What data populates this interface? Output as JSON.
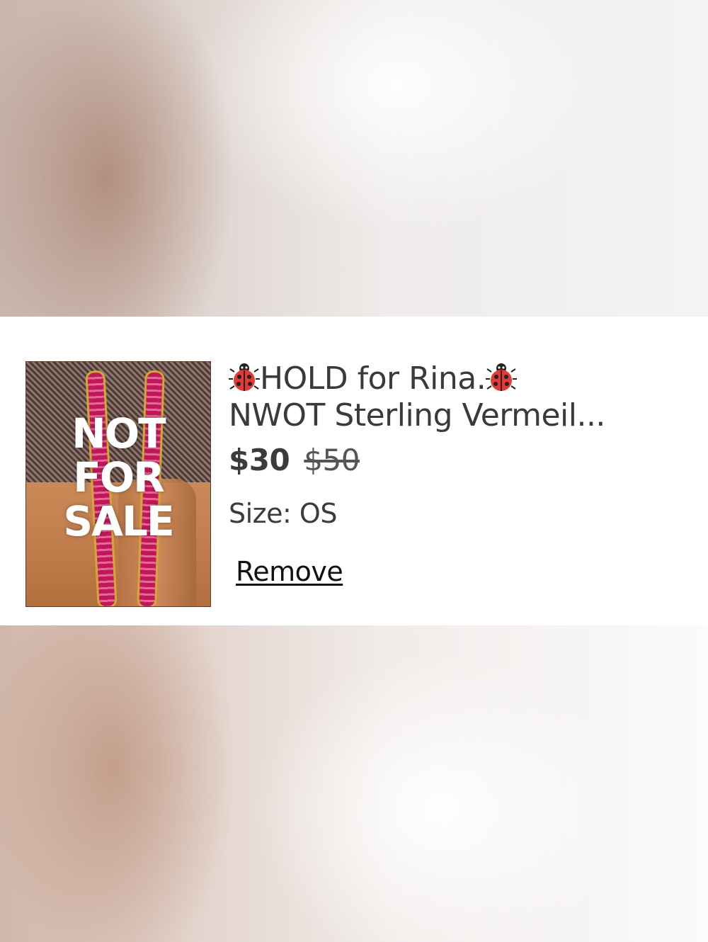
{
  "listing": {
    "image": {
      "overlay_lines": [
        "NOT",
        "FOR",
        "SALE"
      ]
    },
    "title": {
      "leading_icon": "ladybug-icon",
      "line1_text": "HOLD for Rina.",
      "trailing_icon": "ladybug-icon",
      "line2_text": "NWOT Sterling Vermeil..."
    },
    "price": {
      "current": "$30",
      "original": "$50"
    },
    "size": {
      "label": "Size:",
      "value": "OS"
    },
    "remove_label": "Remove"
  },
  "colors": {
    "card_background": "#ffffff",
    "text_primary": "#3b3b3b",
    "ladybug_red": "#e53935",
    "gem_pink": "#c2185b",
    "gold": "#d4a733"
  }
}
